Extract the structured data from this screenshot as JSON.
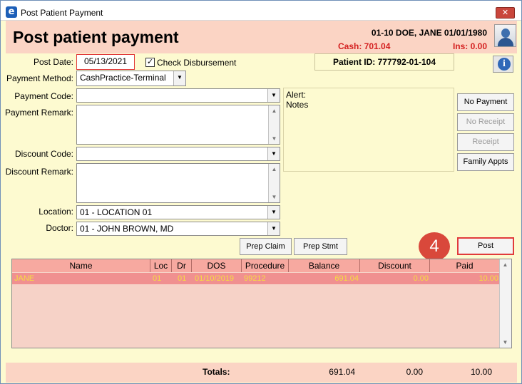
{
  "window": {
    "title": "Post Patient Payment",
    "close_glyph": "✕",
    "app_icon_glyph": "e"
  },
  "header": {
    "page_title": "Post patient payment",
    "patient_line": "01-10 DOE, JANE 01/01/1980",
    "cash": "Cash: 701.04",
    "ins": "Ins: 0.00"
  },
  "form": {
    "post_date_label": "Post Date:",
    "post_date_value": "05/13/2021",
    "check_disbursement_label": "Check Disbursement",
    "check_disbursement_checked": true,
    "payment_method_label": "Payment Method:",
    "payment_method_value": "CashPractice-Terminal",
    "payment_code_label": "Payment Code:",
    "payment_code_value": "",
    "payment_remark_label": "Payment Remark:",
    "discount_code_label": "Discount Code:",
    "discount_code_value": "",
    "discount_remark_label": "Discount Remark:",
    "location_label": "Location:",
    "location_value": "01 - LOCATION 01",
    "doctor_label": "Doctor:",
    "doctor_value": "01 - JOHN BROWN, MD"
  },
  "patient_id": "Patient ID: 777792-01-104",
  "info_glyph": "i",
  "notes": {
    "alert_label": "Alert:",
    "notes_label": "Notes"
  },
  "buttons": {
    "no_payment": "No Payment",
    "no_receipt": "No Receipt",
    "receipt": "Receipt",
    "family_appts": "Family Appts",
    "prep_claim": "Prep Claim",
    "prep_stmt": "Prep Stmt",
    "post": "Post"
  },
  "step_badge": "4",
  "grid": {
    "columns": [
      "Name",
      "Loc",
      "Dr",
      "DOS",
      "Procedure",
      "Balance",
      "Discount",
      "Paid"
    ],
    "rows": [
      {
        "name": "JANE",
        "loc": "01",
        "dr": "01",
        "dos": "01/10/2019",
        "procedure": "99212",
        "balance": "691.04",
        "discount": "0.00",
        "paid": "10.00"
      }
    ]
  },
  "totals": {
    "label": "Totals:",
    "balance": "691.04",
    "discount": "0.00",
    "paid": "10.00"
  },
  "colors": {
    "accent_red": "#d42020",
    "header_bg": "#fbd4c4",
    "panel_bg": "#fdfad0",
    "row_highlight": "#f09090",
    "row_text": "#f5dd40"
  }
}
